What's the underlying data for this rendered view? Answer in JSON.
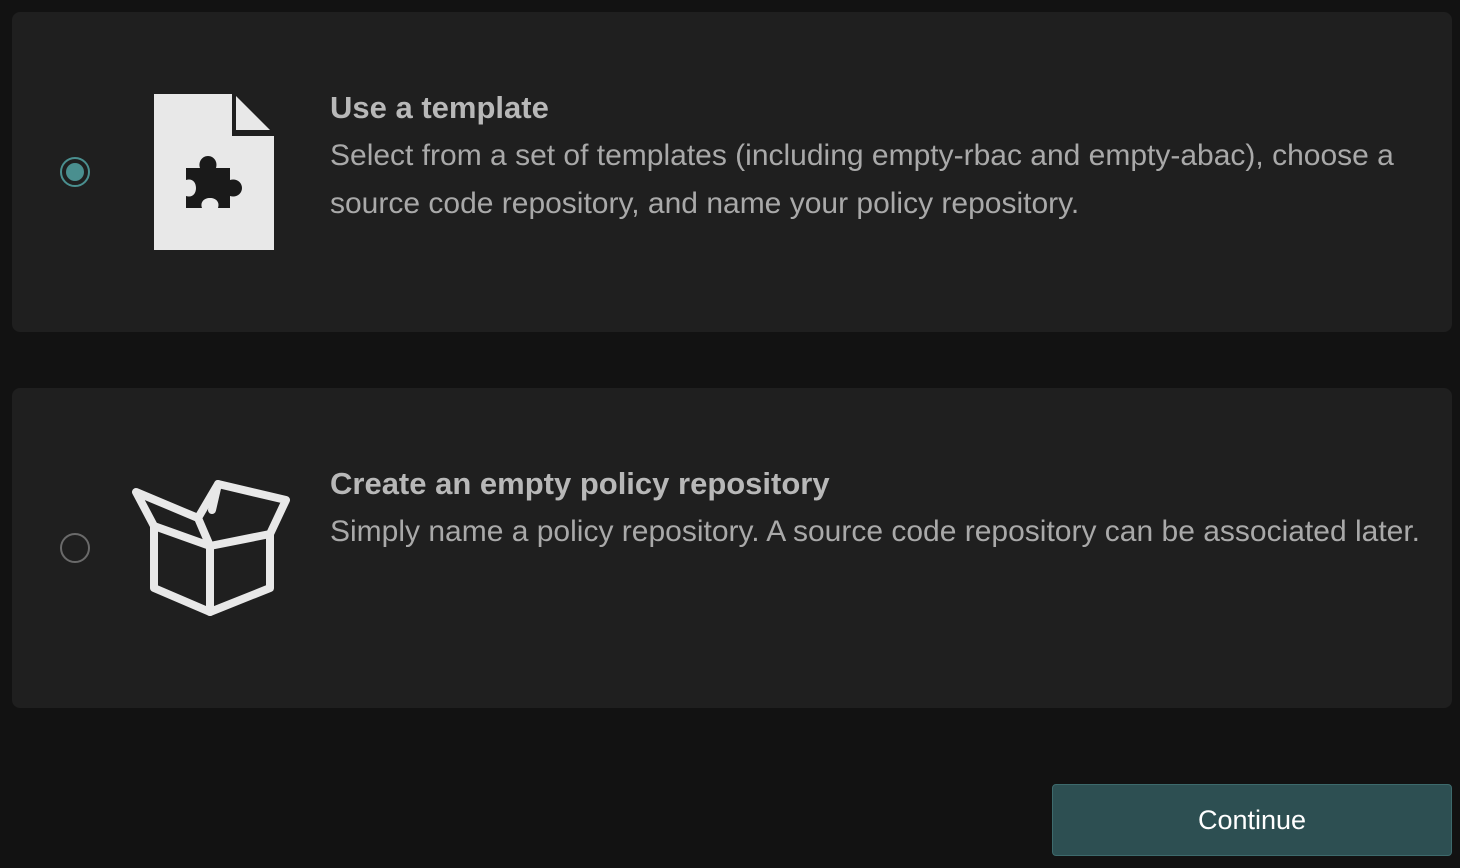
{
  "options": [
    {
      "title": "Use a template",
      "description": "Select from a set of templates (including empty-rbac and empty-abac), choose a source code repository, and name your policy repository.",
      "icon": "puzzle-document-icon",
      "selected": true
    },
    {
      "title": "Create an empty policy repository",
      "description": "Simply name a policy repository. A source code repository can be associated later.",
      "icon": "open-box-icon",
      "selected": false
    }
  ],
  "footer": {
    "continue_label": "Continue"
  },
  "colors": {
    "background": "#121212",
    "card": "#1f1f1f",
    "accent": "#4a8f8f",
    "button": "#2d4f52"
  }
}
